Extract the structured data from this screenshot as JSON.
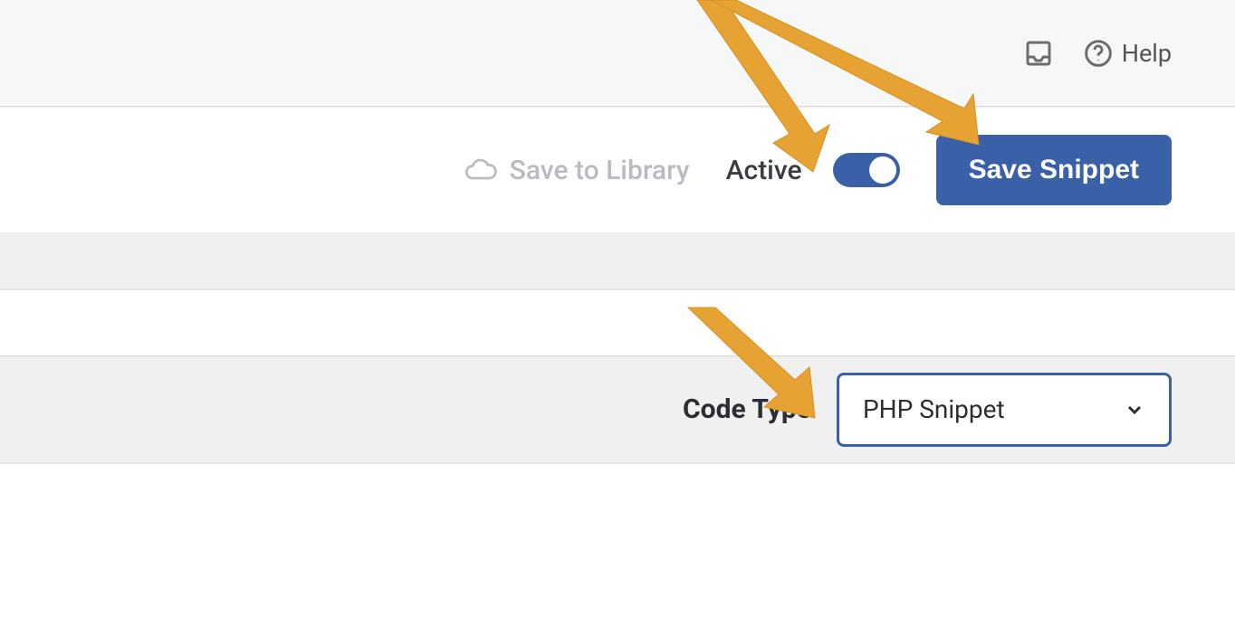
{
  "topbar": {
    "help_label": "Help"
  },
  "actionbar": {
    "save_library_label": "Save to Library",
    "active_label": "Active",
    "toggle_on": true,
    "save_button_label": "Save Snippet"
  },
  "title_row": {
    "value": "",
    "placeholder": ""
  },
  "codetype": {
    "label": "Code Type",
    "selected": "PHP Snippet"
  },
  "colors": {
    "accent": "#3a60a8",
    "annotation_arrow": "#e6a233",
    "muted": "#b8bcc0"
  }
}
